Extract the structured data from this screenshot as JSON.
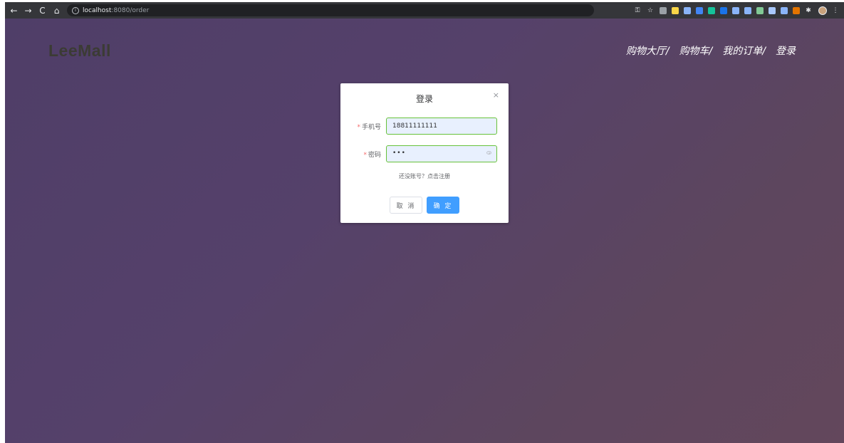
{
  "browser": {
    "url_host": "localhost",
    "url_path": ":8080/order",
    "nav": {
      "back": "←",
      "forward": "→",
      "reload": "C",
      "home": "⌂"
    },
    "icons": [
      "key-icon",
      "star-icon"
    ],
    "extensions": [
      {
        "name": "ext-1",
        "color": "#9aa0a6"
      },
      {
        "name": "ext-2",
        "color": "#f9d648"
      },
      {
        "name": "ext-3",
        "color": "#8ab4f8"
      },
      {
        "name": "ext-new",
        "color": "#4285f4"
      },
      {
        "name": "ext-grammarly",
        "color": "#15c39a"
      },
      {
        "name": "ext-u",
        "color": "#1a73e8"
      },
      {
        "name": "ext-6",
        "color": "#8ab4f8"
      },
      {
        "name": "ext-7",
        "color": "#8ab4f8"
      },
      {
        "name": "ext-8",
        "color": "#81c995"
      },
      {
        "name": "ext-9",
        "color": "#a8c7fa"
      },
      {
        "name": "ext-10",
        "color": "#8ab4f8"
      },
      {
        "name": "ext-11",
        "color": "#e37400"
      }
    ]
  },
  "header": {
    "logo": "LeeMall",
    "nav": [
      "购物大厅/",
      "购物车/",
      "我的订单/",
      "登录"
    ]
  },
  "dialog": {
    "title": "登录",
    "close": "×",
    "phone_label": "手机号",
    "phone_value": "18811111111",
    "password_label": "密码",
    "password_mask": "•••",
    "register_hint": "还没账号？点击注册",
    "cancel_label": "取 消",
    "confirm_label": "确 定",
    "required_mark": "*"
  },
  "colors": {
    "primary": "#409eff",
    "success_border": "#67c23a",
    "required": "#f56c6c"
  }
}
